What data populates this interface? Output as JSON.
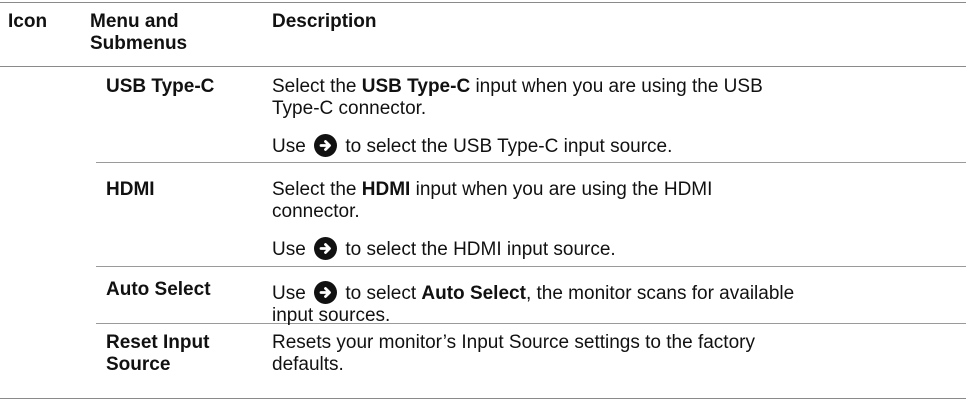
{
  "header": {
    "icon": "Icon",
    "menu_line1": "Menu and",
    "menu_line2": "Submenus",
    "description": "Description"
  },
  "rows": [
    {
      "menu_line1": "USB Type-C",
      "d1_pre": "Select the ",
      "d1_bold": "USB Type-C",
      "d1_post": "  input when you are using the USB",
      "d1_line2": "Type-C connector.",
      "d2_pre": "Use",
      "d2_post": "to select the USB Type-C input source."
    },
    {
      "menu_line1": "HDMI",
      "d1_pre": "Select the ",
      "d1_bold": "HDMI",
      "d1_post": " input when you are using the HDMI",
      "d1_line2": "connector.",
      "d2_pre": "Use",
      "d2_post": "to select the HDMI input source."
    },
    {
      "menu_line1": "Auto Select",
      "d1_pre": "Use",
      "d1_mid": "to select ",
      "d1_bold": "Auto Select",
      "d1_post": ", the monitor scans for available",
      "d1_line2": "input sources."
    },
    {
      "menu_line1": "Reset Input",
      "menu_line2": "Source",
      "d1_line1": "Resets your monitor’s Input Source settings to the factory",
      "d1_line2": "defaults."
    }
  ],
  "icons": {
    "arrow": "arrow-right-circle-icon"
  }
}
